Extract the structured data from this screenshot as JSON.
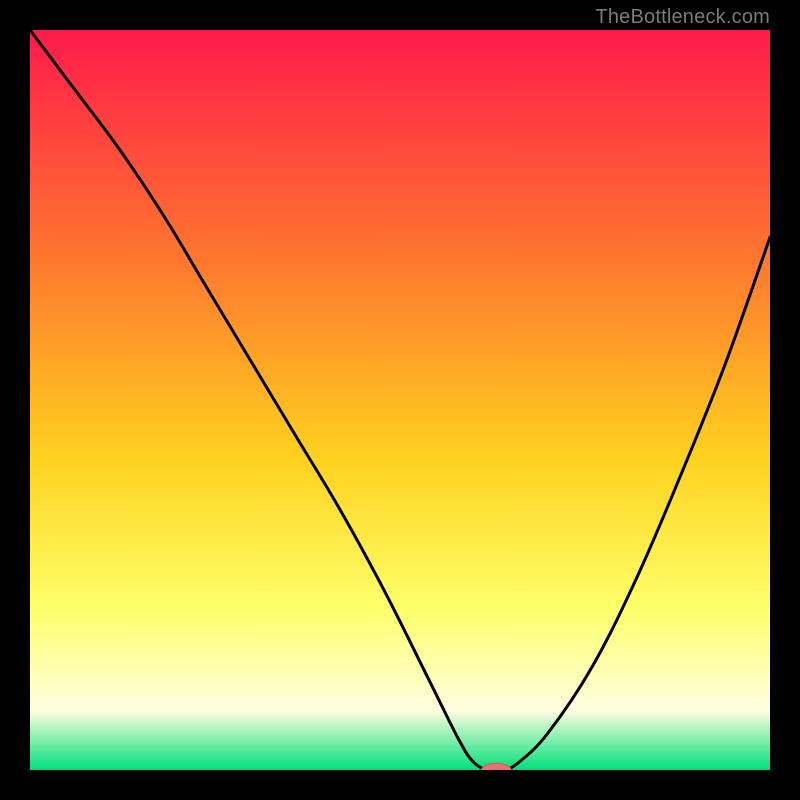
{
  "watermark": "TheBottleneck.com",
  "colors": {
    "frame": "#000000",
    "grad_top": "#ff1a4b",
    "grad_mid1": "#ff7a2e",
    "grad_mid2": "#ffd21f",
    "grad_mid3": "#ffff6a",
    "grad_mid4": "#fffde0",
    "grad_bottom": "#00e07a",
    "curve": "#000000",
    "marker_fill": "#e57373",
    "marker_stroke": "#cc5555"
  },
  "chart_data": {
    "type": "line",
    "title": "",
    "xlabel": "",
    "ylabel": "",
    "xlim": [
      0,
      100
    ],
    "ylim": [
      0,
      100
    ],
    "grid": false,
    "legend": false,
    "series": [
      {
        "name": "bottleneck-curve",
        "x": [
          0,
          6,
          12,
          18,
          24,
          30,
          36,
          42,
          48,
          54,
          58,
          60,
          62,
          64,
          66,
          70,
          76,
          82,
          88,
          94,
          100
        ],
        "y": [
          100,
          92,
          84,
          75,
          65,
          55,
          45,
          35,
          24,
          12,
          4,
          1,
          0,
          0,
          1,
          5,
          14,
          26,
          40,
          55,
          72
        ]
      }
    ],
    "marker": {
      "x": 63,
      "y": 0,
      "rx": 2.0,
      "ry": 0.9
    }
  }
}
